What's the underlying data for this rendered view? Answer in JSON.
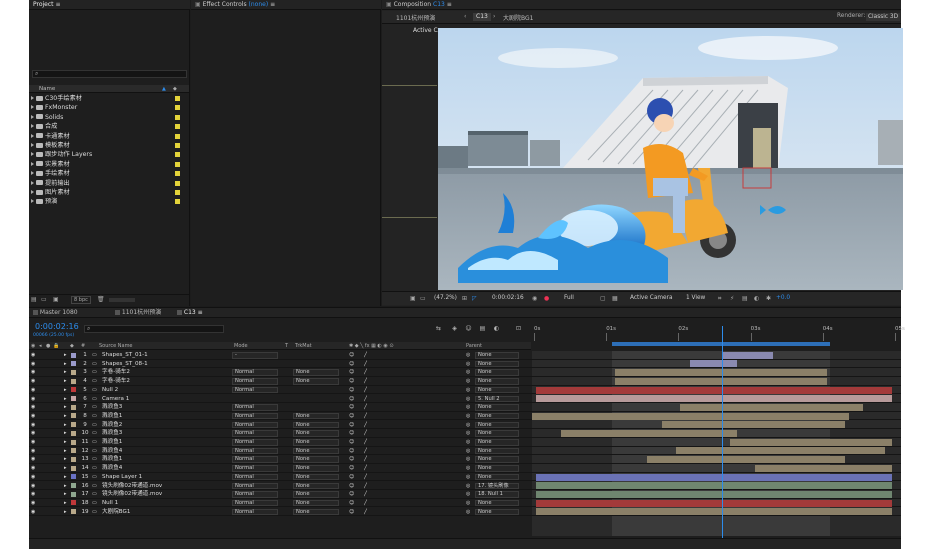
{
  "project": {
    "title": "Project",
    "search_placeholder": "",
    "col_name": "Name",
    "items": [
      {
        "label": "C30手绘素材"
      },
      {
        "label": "FxMonster"
      },
      {
        "label": "Solids"
      },
      {
        "label": "合成"
      },
      {
        "label": "卡通素材"
      },
      {
        "label": "模板素材"
      },
      {
        "label": "跟步动作 Layers"
      },
      {
        "label": "实景素材"
      },
      {
        "label": "手绘素材"
      },
      {
        "label": "提前输出"
      },
      {
        "label": "图片素材"
      },
      {
        "label": "预演"
      }
    ],
    "bpc": "8 bpc"
  },
  "effect_controls": {
    "title": "Effect Controls",
    "target": "(none)"
  },
  "composition": {
    "title": "Composition",
    "comp_name": "C13",
    "breadcrumb_1": "1101杭州预演",
    "breadcrumb_2": "C13",
    "breadcrumb_3": "大剧院BG1",
    "renderer_label": "Renderer:",
    "renderer_value": "Classic 3D",
    "active_camera": "Active Camera",
    "zoom": "(47.2%)",
    "timecode": "0:00:02:16",
    "resolution": "Full",
    "camera_view": "Active Camera",
    "views": "1 View",
    "exposure": "+0.0"
  },
  "timeline": {
    "tabs": [
      {
        "label": "Master 1080"
      },
      {
        "label": "1101杭州预演"
      },
      {
        "label": "C13"
      }
    ],
    "timecode": "0:00:02:16",
    "timecode_sub": "00066 (25.00 fps)",
    "col_source": "Source Name",
    "col_mode": "Mode",
    "col_t": "T",
    "col_trkmat": "TrkMat",
    "col_parent": "Parent",
    "ruler": [
      "0s",
      "01s",
      "02s",
      "03s",
      "04s",
      "05s"
    ],
    "playhead_pct": 0.527,
    "colors": {
      "accent": "#2d8ceb",
      "bar_tan": "#8b8068",
      "bar_red": "#a33a3a",
      "bar_pink": "#b79a9a",
      "bar_lav": "#8a8ab0",
      "bar_sage": "#6f8670",
      "bar_blue": "#6a72b5"
    },
    "layers": [
      {
        "num": "1",
        "name": "Shapes_ST_01-1",
        "mode": "-",
        "trk": "",
        "parent": "None",
        "color": "#9a9acb",
        "bar": [
          0.53,
          0.67
        ],
        "bc": "#8a8ab0"
      },
      {
        "num": "2",
        "name": "Shapes_ST_08-1",
        "mode": "",
        "trk": "",
        "parent": "None",
        "color": "#9a9acb",
        "bar": [
          0.44,
          0.57
        ],
        "bc": "#8a8ab0"
      },
      {
        "num": "3",
        "name": "字卷-骑车2",
        "mode": "Normal",
        "trk": "None",
        "parent": "None",
        "color": "#b9a98a",
        "bar": [
          0.23,
          0.82
        ],
        "bc": "#8b8068"
      },
      {
        "num": "4",
        "name": "字卷-骑车2",
        "mode": "Normal",
        "trk": "None",
        "parent": "None",
        "color": "#b9a98a",
        "bar": [
          0.23,
          0.82
        ],
        "bc": "#8b8068"
      },
      {
        "num": "5",
        "name": "Null 2",
        "mode": "Normal",
        "trk": "",
        "parent": "None",
        "color": "#c0383a",
        "bar": [
          0.01,
          1.0
        ],
        "bc": "#a33a3a"
      },
      {
        "num": "6",
        "name": "Camera 1",
        "mode": "",
        "trk": "",
        "parent": "5. Null 2",
        "color": "#c8a8a8",
        "bar": [
          0.01,
          1.0
        ],
        "bc": "#b79a9a"
      },
      {
        "num": "7",
        "name": "溅浪鱼3",
        "mode": "Normal",
        "trk": "",
        "parent": "None",
        "color": "#b9a98a",
        "bar": [
          0.41,
          0.92
        ],
        "bc": "#8b8068"
      },
      {
        "num": "8",
        "name": "溅浪鱼1",
        "mode": "Normal",
        "trk": "None",
        "parent": "None",
        "color": "#b9a98a",
        "bar": [
          0.0,
          0.88
        ],
        "bc": "#8b8068"
      },
      {
        "num": "9",
        "name": "溅浪鱼2",
        "mode": "Normal",
        "trk": "None",
        "parent": "None",
        "color": "#b9a98a",
        "bar": [
          0.36,
          0.87
        ],
        "bc": "#8b8068"
      },
      {
        "num": "10",
        "name": "溅浪鱼3",
        "mode": "Normal",
        "trk": "None",
        "parent": "None",
        "color": "#b9a98a",
        "bar": [
          0.08,
          0.57
        ],
        "bc": "#8b8068"
      },
      {
        "num": "11",
        "name": "溅浪鱼1",
        "mode": "Normal",
        "trk": "None",
        "parent": "None",
        "color": "#b9a98a",
        "bar": [
          0.55,
          1.0
        ],
        "bc": "#8b8068"
      },
      {
        "num": "12",
        "name": "溅浪鱼4",
        "mode": "Normal",
        "trk": "None",
        "parent": "None",
        "color": "#b9a98a",
        "bar": [
          0.4,
          0.98
        ],
        "bc": "#8b8068"
      },
      {
        "num": "13",
        "name": "溅浪鱼1",
        "mode": "Normal",
        "trk": "None",
        "parent": "None",
        "color": "#b9a98a",
        "bar": [
          0.32,
          0.87
        ],
        "bc": "#8b8068"
      },
      {
        "num": "14",
        "name": "溅浪鱼4",
        "mode": "Normal",
        "trk": "None",
        "parent": "None",
        "color": "#b9a98a",
        "bar": [
          0.62,
          1.0
        ],
        "bc": "#8b8068"
      },
      {
        "num": "15",
        "name": "Shape Layer 1",
        "mode": "Normal",
        "trk": "None",
        "parent": "None",
        "color": "#6a72c5",
        "bar": [
          0.01,
          1.0
        ],
        "bc": "#6a72b5"
      },
      {
        "num": "16",
        "name": "镜头刷像02带通道.mov",
        "mode": "Normal",
        "trk": "None",
        "parent": "17. 镜头刷像",
        "color": "#8fa890",
        "bar": [
          0.01,
          1.0
        ],
        "bc": "#6f8670"
      },
      {
        "num": "17",
        "name": "镜头刷像02带通道.mov",
        "mode": "Normal",
        "trk": "None",
        "parent": "18. Null 1",
        "color": "#8fa890",
        "bar": [
          0.01,
          1.0
        ],
        "bc": "#6f8670"
      },
      {
        "num": "18",
        "name": "Null 1",
        "mode": "Normal",
        "trk": "None",
        "parent": "None",
        "color": "#c0383a",
        "bar": [
          0.01,
          1.0
        ],
        "bc": "#a33a3a"
      },
      {
        "num": "19",
        "name": "大剧院BG1",
        "mode": "Normal",
        "trk": "None",
        "parent": "None",
        "color": "#b9a98a",
        "bar": [
          0.01,
          1.0
        ],
        "bc": "#8b8068"
      }
    ]
  }
}
